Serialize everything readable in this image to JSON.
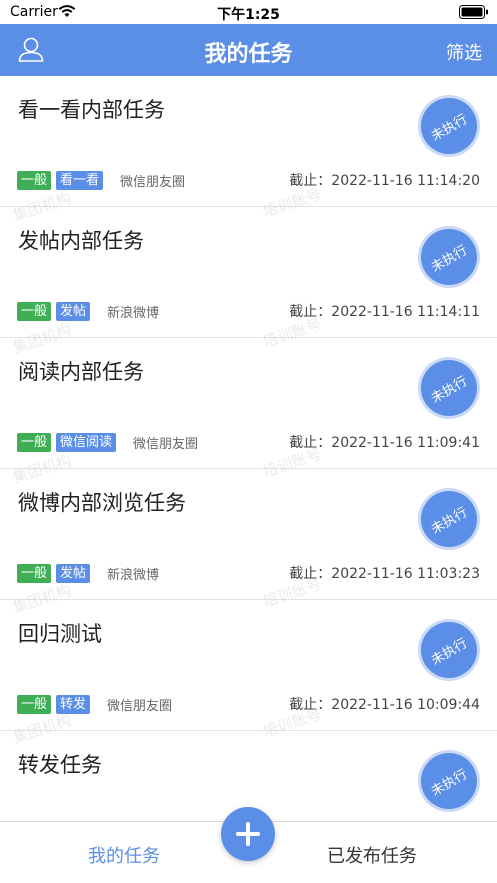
{
  "status_bar": {
    "carrier": "Carrier",
    "time": "下午1:25"
  },
  "nav": {
    "title": "我的任务",
    "filter_label": "筛选"
  },
  "tasks": [
    {
      "title": "看一看内部任务",
      "status": "未执行",
      "level": "一般",
      "type": "看一看",
      "platform": "微信朋友圈",
      "deadline": "截止：2022-11-16 11:14:20"
    },
    {
      "title": "发帖内部任务",
      "status": "未执行",
      "level": "一般",
      "type": "发帖",
      "platform": "新浪微博",
      "deadline": "截止：2022-11-16 11:14:11"
    },
    {
      "title": "阅读内部任务",
      "status": "未执行",
      "level": "一般",
      "type": "微信阅读",
      "platform": "微信朋友圈",
      "deadline": "截止：2022-11-16 11:09:41"
    },
    {
      "title": "微博内部浏览任务",
      "status": "未执行",
      "level": "一般",
      "type": "发帖",
      "platform": "新浪微博",
      "deadline": "截止：2022-11-16 11:03:23"
    },
    {
      "title": "回归测试",
      "status": "未执行",
      "level": "一般",
      "type": "转发",
      "platform": "微信朋友圈",
      "deadline": "截止：2022-11-16 10:09:44"
    },
    {
      "title": "转发任务",
      "status": "未执行"
    }
  ],
  "watermarks": {
    "org": "集团机构",
    "account": "培训账号"
  },
  "tab_bar": {
    "my_tasks": "我的任务",
    "published": "已发布任务"
  },
  "colors": {
    "primary": "#5b8ee6",
    "level_tag": "#3fae54"
  },
  "icons": {
    "user": "user-icon",
    "add": "plus-icon",
    "wifi": "wifi-icon",
    "battery": "battery-icon"
  }
}
